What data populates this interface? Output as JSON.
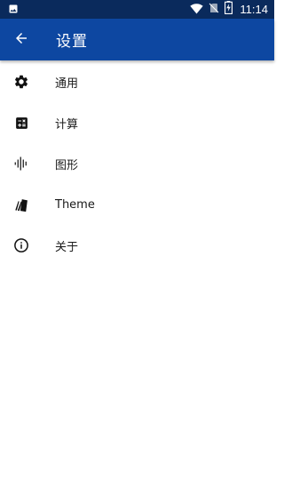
{
  "status_bar": {
    "time": "11:14",
    "icons": [
      "image-icon",
      "wifi-icon",
      "no-sim-icon",
      "battery-charging-icon"
    ]
  },
  "app_bar": {
    "title": "设置",
    "back_icon": "arrow-back-icon"
  },
  "menu": [
    {
      "label": "通用",
      "icon": "gear-icon"
    },
    {
      "label": "计算",
      "icon": "calculator-icon"
    },
    {
      "label": "图形",
      "icon": "waveform-icon"
    },
    {
      "label": "Theme",
      "icon": "palette-swatch-icon"
    },
    {
      "label": "关于",
      "icon": "info-icon"
    }
  ],
  "colors": {
    "status_bar": "#0a2a5c",
    "app_bar": "#0d47a1",
    "icon": "#111111"
  }
}
